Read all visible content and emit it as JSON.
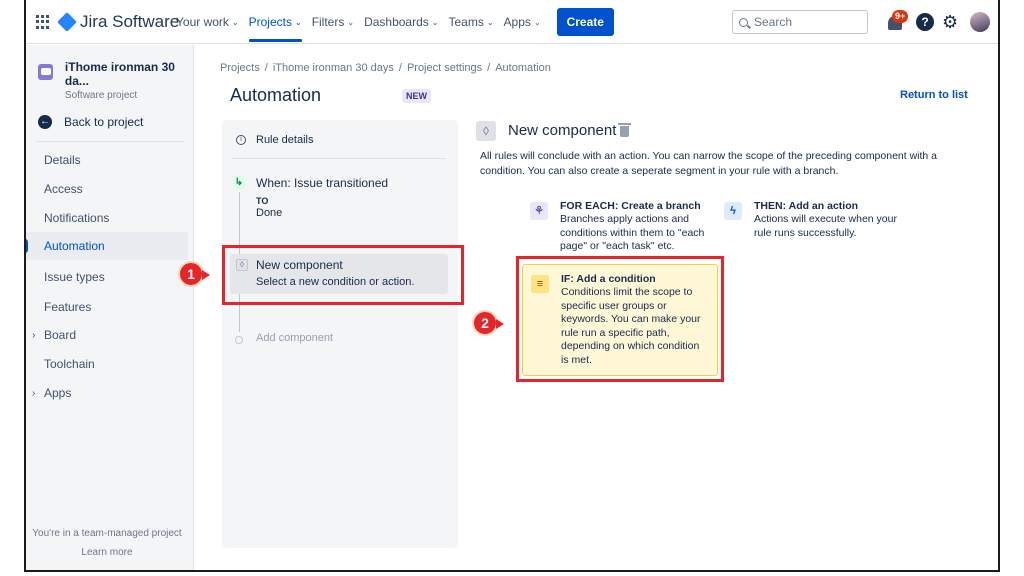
{
  "nav": {
    "app_name": "Jira Software",
    "items": [
      {
        "label": "Your work"
      },
      {
        "label": "Projects"
      },
      {
        "label": "Filters"
      },
      {
        "label": "Dashboards"
      },
      {
        "label": "Teams"
      },
      {
        "label": "Apps"
      }
    ],
    "active_item": "Projects",
    "create_label": "Create",
    "search_placeholder": "Search",
    "notification_count": "9+",
    "help_glyph": "?",
    "brand_color": "#0052cc"
  },
  "sidebar": {
    "project_name": "iThome ironman 30 da...",
    "project_type": "Software project",
    "back_label": "Back to project",
    "items": [
      {
        "label": "Details",
        "caret": ""
      },
      {
        "label": "Access",
        "caret": ""
      },
      {
        "label": "Notifications",
        "caret": ""
      },
      {
        "label": "Automation",
        "caret": "",
        "active": true
      },
      {
        "label": "Issue types",
        "caret": ""
      },
      {
        "label": "Features",
        "caret": ""
      },
      {
        "label": "Board",
        "caret": "›"
      },
      {
        "label": "Toolchain",
        "caret": ""
      },
      {
        "label": "Apps",
        "caret": "›"
      }
    ],
    "footer_text": "You're in a team-managed project",
    "footer_link": "Learn more"
  },
  "main": {
    "breadcrumbs": [
      "Projects",
      "iThome ironman 30 days",
      "Project settings",
      "Automation"
    ],
    "breadcrumb_sep": "/",
    "title": "Automation",
    "lozenge": "NEW",
    "return_link": "Return to list"
  },
  "rule": {
    "details_label": "Rule details",
    "trigger_title": "When: Issue transitioned",
    "trigger_to_label": "TO",
    "trigger_to_value": "Done",
    "new_component_title": "New component",
    "new_component_sub": "Select a new condition or action.",
    "add_component": "Add component"
  },
  "component": {
    "title": "New component",
    "description": "All rules will conclude with an action. You can narrow the scope of the preceding component with a condition. You can also create a seperate segment in your rule with a branch.",
    "options": {
      "branch": {
        "title": "FOR EACH: Create a branch",
        "body": "Branches apply actions and conditions within them to \"each page\" or \"each task\" etc.",
        "icon": "branch-icon",
        "color": "#6554c0"
      },
      "action": {
        "title": "THEN: Add an action",
        "body": "Actions will execute when your rule runs successfully.",
        "icon": "lightning-icon",
        "color": "#0052cc"
      },
      "condition": {
        "title": "IF: Add a condition",
        "body": "Conditions limit the scope to specific user groups or keywords. You can make your rule run a specific path, depending on which condition is met.",
        "icon": "filter-icon",
        "color": "#ff991f"
      }
    }
  },
  "annotations": {
    "callout_1": "1",
    "callout_2": "2",
    "highlight_color": "#e5252a"
  }
}
